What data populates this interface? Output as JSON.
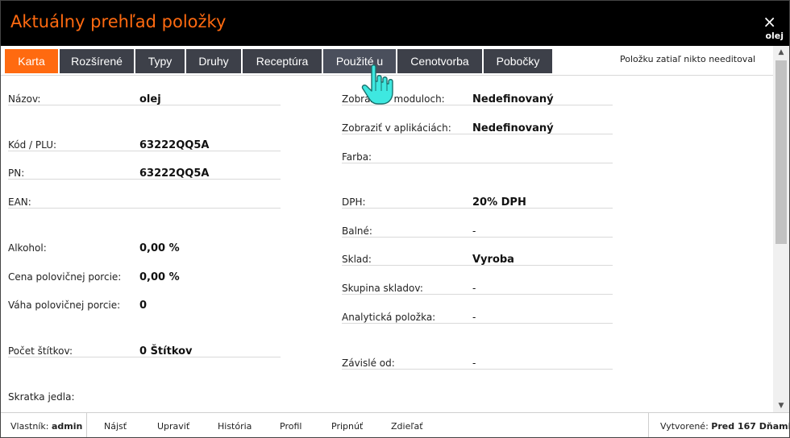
{
  "window": {
    "title": "Aktuálny prehľad položky",
    "close_glyph": "×",
    "item_name": "olej"
  },
  "tabs": [
    {
      "label": "Karta",
      "active": true
    },
    {
      "label": "Rozšírené"
    },
    {
      "label": "Typy"
    },
    {
      "label": "Druhy"
    },
    {
      "label": "Receptúra"
    },
    {
      "label": "Použité u",
      "hovered": true
    },
    {
      "label": "Cenotvorba"
    },
    {
      "label": "Pobočky"
    }
  ],
  "edited_note": "Položku zatiaľ nikto needitoval",
  "left": {
    "nazov": {
      "label": "Názov:",
      "value": "olej"
    },
    "kod": {
      "label": "Kód / PLU:",
      "value": "63222QQ5A"
    },
    "pn": {
      "label": "PN:",
      "value": "63222QQ5A"
    },
    "ean": {
      "label": "EAN:",
      "value": ""
    },
    "alkohol": {
      "label": "Alkohol:",
      "value": "0,00 %"
    },
    "cena_pol": {
      "label": "Cena polovičnej porcie:",
      "value": "0,00 %"
    },
    "vaha_pol": {
      "label": "Váha polovičnej porcie:",
      "value": "0"
    },
    "pocet_stitkov": {
      "label": "Počet štítkov:",
      "value": "0 Štítkov"
    },
    "skratka": {
      "label": "Skratka jedla:",
      "value": ""
    }
  },
  "right": {
    "zobrazit_moduloch": {
      "label": "Zobraziť v moduloch:",
      "value": "Nedefinovaný"
    },
    "zobrazit_aplikaciach": {
      "label": "Zobraziť v aplikáciách:",
      "value": "Nedefinovaný"
    },
    "farba": {
      "label": "Farba:",
      "value": ""
    },
    "dph": {
      "label": "DPH:",
      "value": "20% DPH"
    },
    "balne": {
      "label": "Balné:",
      "value": "-"
    },
    "sklad": {
      "label": "Sklad:",
      "value": "Vyroba"
    },
    "skupina_skladov": {
      "label": "Skupina skladov:",
      "value": "-"
    },
    "analyticka": {
      "label": "Analytická položka:",
      "value": "-"
    },
    "zavisle": {
      "label": "Závislé od:",
      "value": "-"
    }
  },
  "footer": {
    "owner_label": "Vlastník:",
    "owner_value": "admin",
    "actions": [
      "Nájsť",
      "Upraviť",
      "História",
      "Profil",
      "Pripnúť",
      "Zdieľať"
    ],
    "created_label": "Vytvorené:",
    "created_value": "Pred 167 Dňami"
  },
  "icons": {
    "scroll_up": "▲",
    "scroll_down": "▼",
    "cursor": "hand-pointer-icon"
  },
  "colors": {
    "accent": "#ff6a10",
    "titlebar": "#000000",
    "tab": "#3d4049",
    "cursor": "#3ee8e0"
  }
}
